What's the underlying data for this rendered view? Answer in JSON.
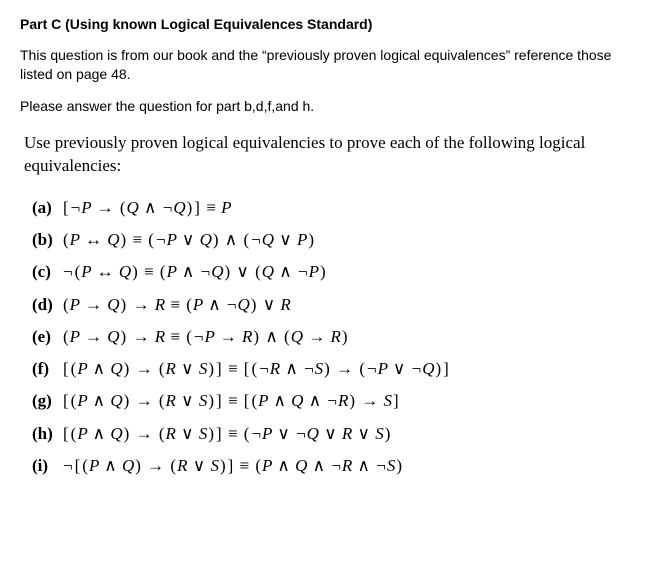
{
  "title": "Part C (Using known Logical Equivalences Standard)",
  "intro": "This question is from our book and the “previously proven logical equivalences” reference those listed on page 48.",
  "instr": "Please answer the question for part b,d,f,and h.",
  "use": "Use previously proven logical equivalencies to prove each of the following logical equivalencies:",
  "items": {
    "a": {
      "label": "(a)",
      "expr": "[¬P → (Q ∧ ¬Q)] ≡ P"
    },
    "b": {
      "label": "(b)",
      "expr": "(P ↔ Q) ≡ (¬P ∨ Q) ∧ (¬Q ∨ P)"
    },
    "c": {
      "label": "(c)",
      "expr": "¬(P ↔ Q) ≡ (P ∧ ¬Q) ∨ (Q ∧ ¬P)"
    },
    "d": {
      "label": "(d)",
      "expr": "(P → Q) → R ≡ (P ∧ ¬Q) ∨ R"
    },
    "e": {
      "label": "(e)",
      "expr": "(P → Q) → R ≡ (¬P → R) ∧ (Q → R)"
    },
    "f": {
      "label": "(f)",
      "expr": "[(P ∧ Q) → (R ∨ S)] ≡ [(¬R ∧ ¬S) → (¬P ∨ ¬Q)]"
    },
    "g": {
      "label": "(g)",
      "expr": "[(P ∧ Q) → (R ∨ S)] ≡ [(P ∧ Q ∧ ¬R) → S]"
    },
    "h": {
      "label": "(h)",
      "expr": "[(P ∧ Q) → (R ∨ S)] ≡ (¬P ∨ ¬Q ∨ R ∨ S)"
    },
    "i": {
      "label": "(i)",
      "expr": "¬[(P ∧ Q) → (R ∨ S)] ≡ (P ∧ Q ∧ ¬R ∧ ¬S)"
    }
  }
}
